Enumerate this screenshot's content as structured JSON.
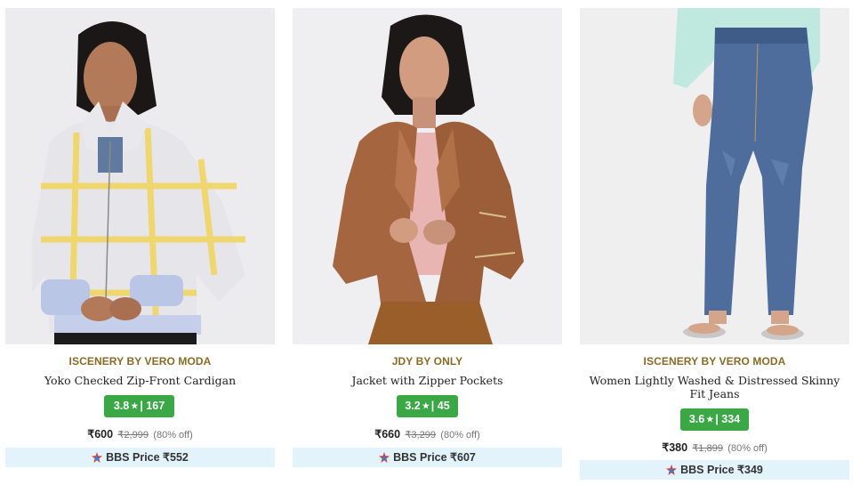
{
  "products": [
    {
      "brand": "ISCENERY BY VERO MODA",
      "title": "Yoko Checked Zip-Front Cardigan",
      "rating": "3.8",
      "rating_count": "167",
      "price": "₹600",
      "mrp": "₹2,999",
      "discount": "(80% off)",
      "bbs_price": "BBS Price ₹552",
      "image_icon": "cardigan-product-image"
    },
    {
      "brand": "JDY BY ONLY",
      "title": "Jacket with Zipper Pockets",
      "rating": "3.2",
      "rating_count": "45",
      "price": "₹660",
      "mrp": "₹3,299",
      "discount": "(80% off)",
      "bbs_price": "BBS Price ₹607",
      "image_icon": "jacket-product-image"
    },
    {
      "brand": "ISCENERY BY VERO MODA",
      "title": "Women Lightly Washed & Distressed Skinny Fit Jeans",
      "rating": "3.6",
      "rating_count": "334",
      "price": "₹380",
      "mrp": "₹1,899",
      "discount": "(80% off)",
      "bbs_price": "BBS Price ₹349",
      "image_icon": "jeans-product-image"
    }
  ],
  "rating_star": "★",
  "rating_sep": "|",
  "colors": {
    "brand_text": "#8a6a26",
    "rating_badge": "#3aa845",
    "bbs_background": "#e3f3fb"
  }
}
